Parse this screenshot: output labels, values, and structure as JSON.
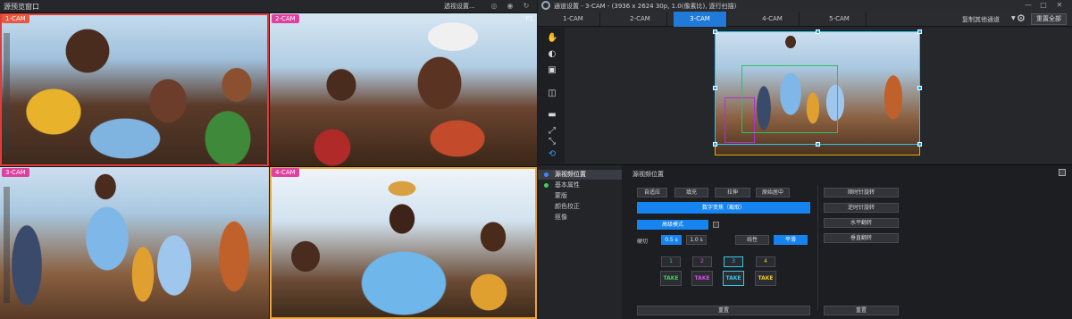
{
  "left": {
    "title": "源预览窗口",
    "settings_label": "透视设置...",
    "cams": [
      {
        "label": "1-CAM",
        "tag_color": "#e8573f",
        "border_color": "#e23c3c",
        "corner": ""
      },
      {
        "label": "2-CAM",
        "tag_color": "#e040a0",
        "border_color": "",
        "corner": "F1"
      },
      {
        "label": "3-CAM",
        "tag_color": "#e040a0",
        "border_color": "",
        "corner": ""
      },
      {
        "label": "4-CAM",
        "tag_color": "#e040a0",
        "border_color": "#e8a73a",
        "corner": ""
      }
    ]
  },
  "right": {
    "title": "通道设置 - 3-CAM  - (3936 x 2624 30p, 1.0(像素比), 逐行扫描)",
    "tabs": [
      "1-CAM",
      "2-CAM",
      "3-CAM",
      "4-CAM",
      "5-CAM"
    ],
    "active_tab": 2,
    "copy_label": "复制其他通道",
    "reset_all": "重置全部",
    "nav": [
      {
        "label": "源视频位置",
        "dot": "#3b8af0",
        "active": true
      },
      {
        "label": "基本属性",
        "dot": "#3fcf5a",
        "active": false
      },
      {
        "label": "蒙版",
        "dot": "",
        "active": false
      },
      {
        "label": "颜色校正",
        "dot": "",
        "active": false
      },
      {
        "label": "抠像",
        "dot": "",
        "active": false
      }
    ],
    "settings": {
      "title": "源视频位置",
      "fit_buttons": [
        "自适应",
        "填充",
        "拉伸",
        "原始居中"
      ],
      "digital_zoom": "数字变焦（截取）",
      "advanced": "高级模式",
      "hard_cut": "硬切",
      "durations": [
        "0.5 s",
        "1.0 s"
      ],
      "easing": [
        "线性",
        "平滑"
      ],
      "positions": [
        "1",
        "2",
        "3",
        "4"
      ],
      "take_label": "TAKE",
      "take_colors": [
        "#3fcf5a",
        "#d050e0",
        "#30c8e8",
        "#e8c830"
      ],
      "reset": "重置",
      "rotate_buttons": [
        "顺时针旋转",
        "逆时针旋转",
        "水平翻转",
        "垂直翻转"
      ],
      "reset_right": "重置"
    }
  }
}
